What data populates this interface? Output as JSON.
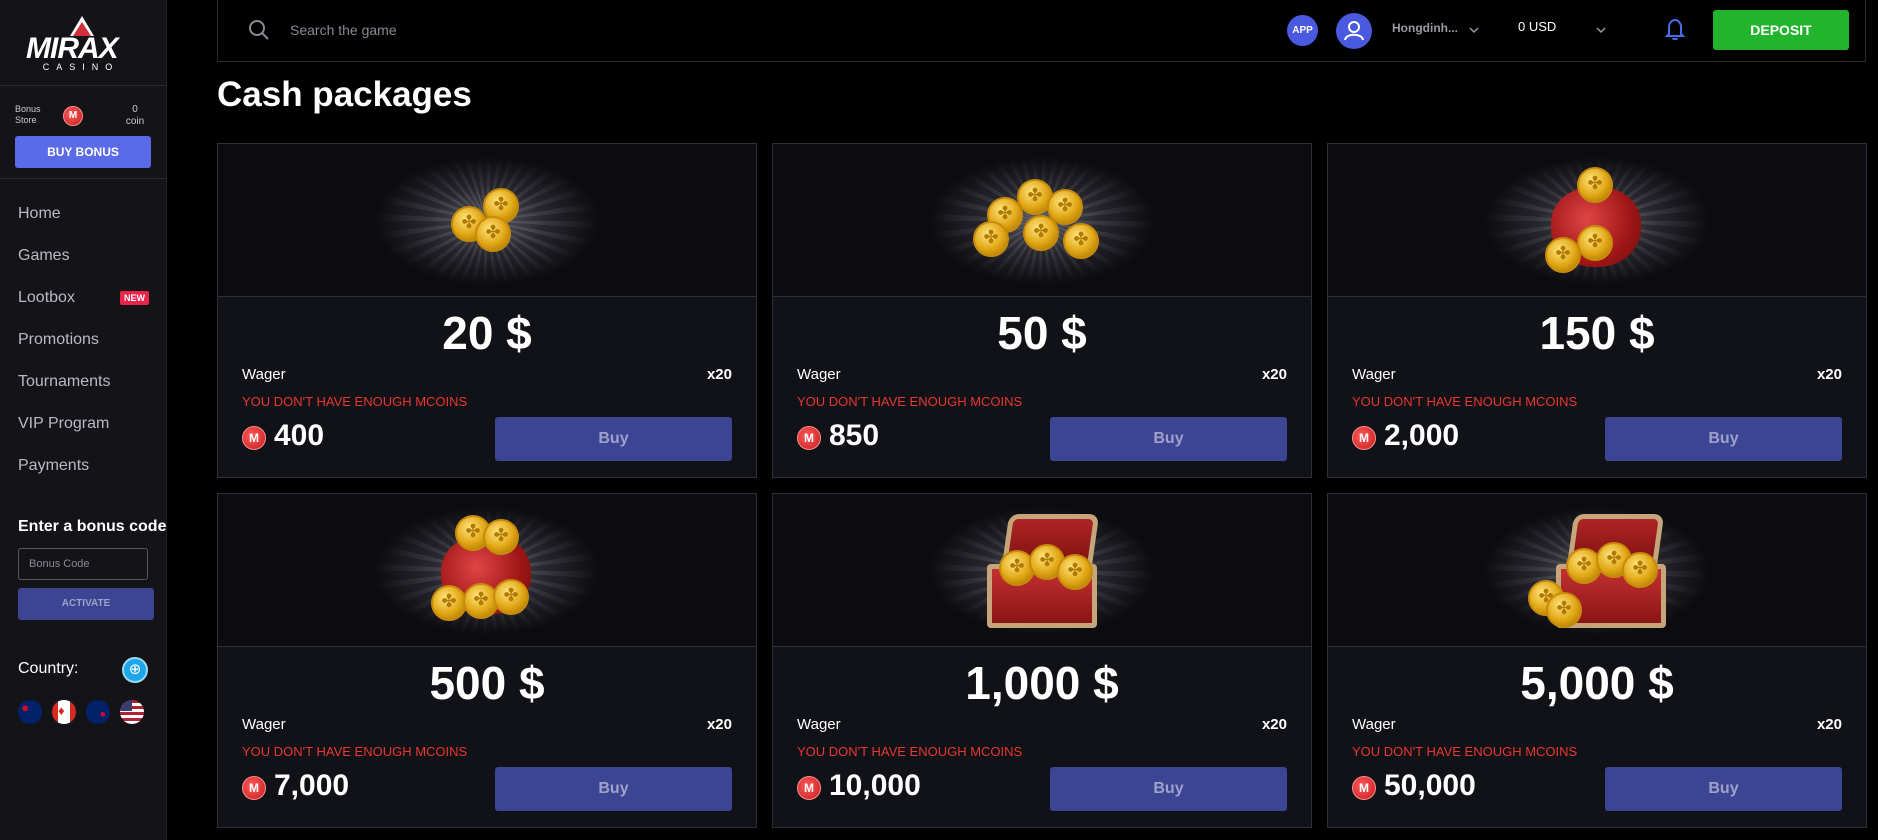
{
  "brand": {
    "name": "MIRAX",
    "sub": "CASINO"
  },
  "sidebar": {
    "bonus_store": {
      "label": "Bonus Store",
      "count": "0",
      "count_unit": "coin"
    },
    "buy_bonus": "BUY BONUS",
    "nav": [
      {
        "label": "Home"
      },
      {
        "label": "Games"
      },
      {
        "label": "Lootbox",
        "badge": "NEW"
      },
      {
        "label": "Promotions"
      },
      {
        "label": "Tournaments"
      },
      {
        "label": "VIP Program"
      },
      {
        "label": "Payments"
      }
    ],
    "bonus_code": {
      "title": "Enter a bonus code",
      "placeholder": "Bonus Code",
      "activate": "ACTIVATE"
    },
    "country": {
      "label": "Country:",
      "flags": [
        "flag-australia-icon",
        "flag-canada-icon",
        "flag-new-zealand-icon",
        "flag-usa-icon"
      ]
    }
  },
  "header": {
    "search_placeholder": "Search the game",
    "app": "APP",
    "username": "Hongdinh...",
    "balance": "0 USD",
    "deposit": "DEPOSIT"
  },
  "page": {
    "title": "Cash packages"
  },
  "packages": [
    {
      "amount": "20 $",
      "wager_label": "Wager",
      "wager": "x20",
      "warning": "YOU DON'T HAVE ENOUGH MCOINS",
      "price": "400",
      "buy": "Buy",
      "art": "coins-small"
    },
    {
      "amount": "50 $",
      "wager_label": "Wager",
      "wager": "x20",
      "warning": "YOU DON'T HAVE ENOUGH MCOINS",
      "price": "850",
      "buy": "Buy",
      "art": "coins-pile"
    },
    {
      "amount": "150 $",
      "wager_label": "Wager",
      "wager": "x20",
      "warning": "YOU DON'T HAVE ENOUGH MCOINS",
      "price": "2,000",
      "buy": "Buy",
      "art": "bag-small"
    },
    {
      "amount": "500 $",
      "wager_label": "Wager",
      "wager": "x20",
      "warning": "YOU DON'T HAVE ENOUGH MCOINS",
      "price": "7,000",
      "buy": "Buy",
      "art": "bag-full"
    },
    {
      "amount": "1,000 $",
      "wager_label": "Wager",
      "wager": "x20",
      "warning": "YOU DON'T HAVE ENOUGH MCOINS",
      "price": "10,000",
      "buy": "Buy",
      "art": "chest"
    },
    {
      "amount": "5,000 $",
      "wager_label": "Wager",
      "wager": "x20",
      "warning": "YOU DON'T HAVE ENOUGH MCOINS",
      "price": "50,000",
      "buy": "Buy",
      "art": "chest-overflow"
    }
  ],
  "colors": {
    "accent": "#5a6ae8",
    "deposit": "#22b42c",
    "warning": "#e8382f",
    "buy_disabled": "#3c4494"
  }
}
